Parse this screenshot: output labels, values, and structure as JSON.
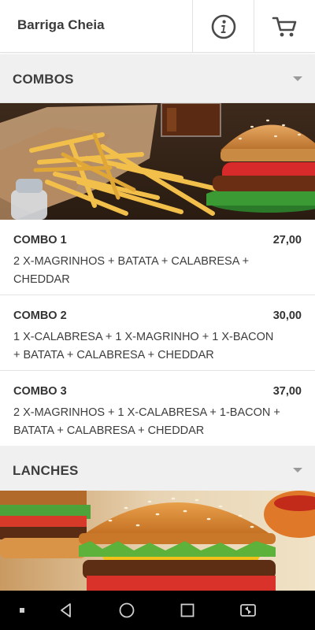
{
  "app": {
    "title": "Barriga Cheia"
  },
  "header": {
    "info_icon": "info-circle-icon",
    "cart_icon": "cart-icon"
  },
  "sections": [
    {
      "label": "COMBOS",
      "banner_image": "fries-burger-soda-photo",
      "items": [
        {
          "name": "COMBO 1",
          "price": "27,00",
          "description": "2 X-MAGRINHOS + BATATA + CALABRESA + CHEDDAR"
        },
        {
          "name": "COMBO 2",
          "price": "30,00",
          "description": "1 X-CALABRESA + 1 X-MAGRINHO + 1 X-BACON + BATATA + CALABRESA + CHEDDAR"
        },
        {
          "name": "COMBO 3",
          "price": "37,00",
          "description": "2 X-MAGRINHOS + 1 X-CALABRESA + 1-BACON + BATATA + CALABRESA + CHEDDAR"
        }
      ]
    },
    {
      "label": "LANCHES",
      "banner_image": "cheeseburger-photo",
      "items": []
    }
  ],
  "navbar": {
    "icons": [
      "menu-dot-icon",
      "back-icon",
      "home-icon",
      "recents-icon",
      "rotate-icon"
    ]
  },
  "colors": {
    "section_bg": "#f0f0f0",
    "navbar_bg": "#000000",
    "text": "#333333"
  }
}
